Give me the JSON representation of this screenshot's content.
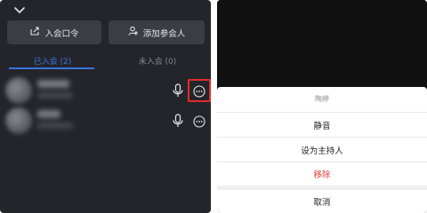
{
  "colors": {
    "accent": "#3a74e0",
    "danger": "#e23b3b",
    "highlight_box": "#e02b2b",
    "panel_bg": "#24252b",
    "button_bg": "#3b3d44"
  },
  "left": {
    "collapse_icon": "chevron-down-icon",
    "buttons": {
      "meeting_password": "入会口令",
      "add_participant": "添加参会人"
    },
    "tabs": {
      "joined": "已入会 (2)",
      "not_joined": "未入会 (0)"
    },
    "participants": [
      {
        "icons": [
          "mic-icon",
          "more-icon"
        ],
        "more_highlighted": true
      },
      {
        "icons": [
          "mic-icon",
          "more-icon"
        ],
        "more_highlighted": false
      }
    ]
  },
  "right": {
    "sheet": {
      "title": "陶婷",
      "mute": "静音",
      "set_host": "设为主持人",
      "remove": "移除",
      "cancel": "取消"
    }
  }
}
